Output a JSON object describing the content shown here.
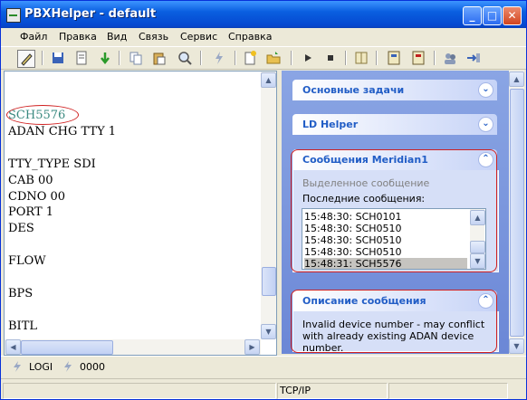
{
  "window": {
    "title": "PBXHelper - default"
  },
  "menu": [
    "Файл",
    "Правка",
    "Вид",
    "Связь",
    "Сервис",
    "Справка"
  ],
  "editor": {
    "lines": [
      "SCH5576",
      "ADAN CHG TTY 1",
      "",
      "TTY_TYPE SDI",
      "CAB 00",
      "CDNO 00",
      "PORT 1",
      "DES",
      "",
      "FLOW",
      "",
      "BPS",
      "",
      "BITL"
    ]
  },
  "panels": {
    "basic_tasks": "Основные задачи",
    "ld_helper": "LD Helper",
    "meridian": {
      "title": "Сообщения Meridian1",
      "selected_label": "Выделенное сообщение",
      "recent_label": "Последние сообщения:",
      "messages": [
        "15:48:30: SCH0101",
        "15:48:30: SCH0510",
        "15:48:30: SCH0510",
        "15:48:30: SCH0510",
        "15:48:31: SCH5576"
      ]
    },
    "description": {
      "title": "Описание сообщения",
      "text": "Invalid device number - may conflict with already existing ADAN device number."
    }
  },
  "status": {
    "logi": "LOGI",
    "count": "0000",
    "protocol": "TCP/IP"
  }
}
